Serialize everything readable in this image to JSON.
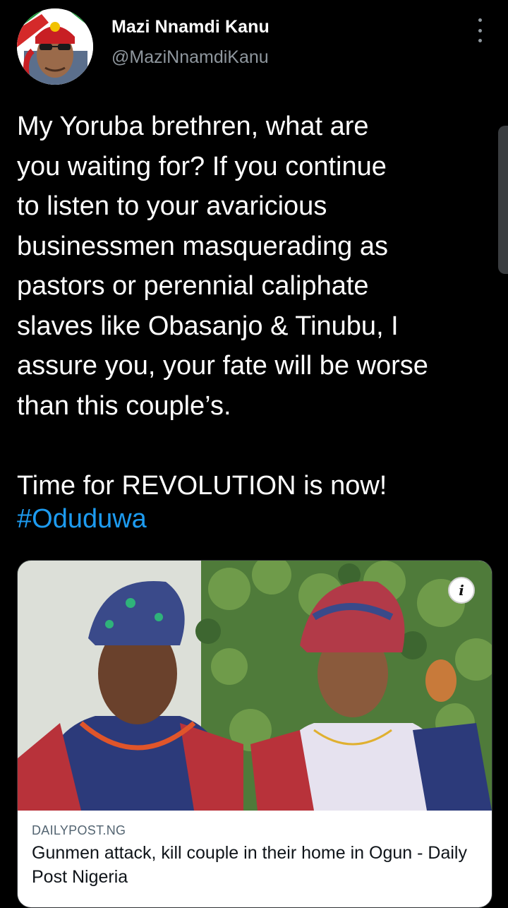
{
  "author": {
    "name": "Mazi Nnamdi Kanu",
    "handle": "@MaziNnamdiKanu"
  },
  "tweet": {
    "text": "My Yoruba brethren, what are\nyou waiting for? If you continue\nto listen to your avaricious\nbusinessmen masquerading as\npastors or perennial caliphate\nslaves like Obasanjo & Tinubu, I\nassure you, your fate will be worse\nthan this couple’s.\n\nTime for REVOLUTION is now!",
    "hashtag": "#Oduduwa"
  },
  "card": {
    "domain": "DAILYPOST.NG",
    "title": "Gunmen attack, kill couple in their home in Ogun - Daily Post Nigeria",
    "info_icon": "info-icon"
  },
  "icons": [
    "more-options-icon",
    "info-icon"
  ],
  "colors": {
    "background": "#000000",
    "text": "#ffffff",
    "secondary": "#8f979e",
    "link": "#1d9bf0"
  }
}
